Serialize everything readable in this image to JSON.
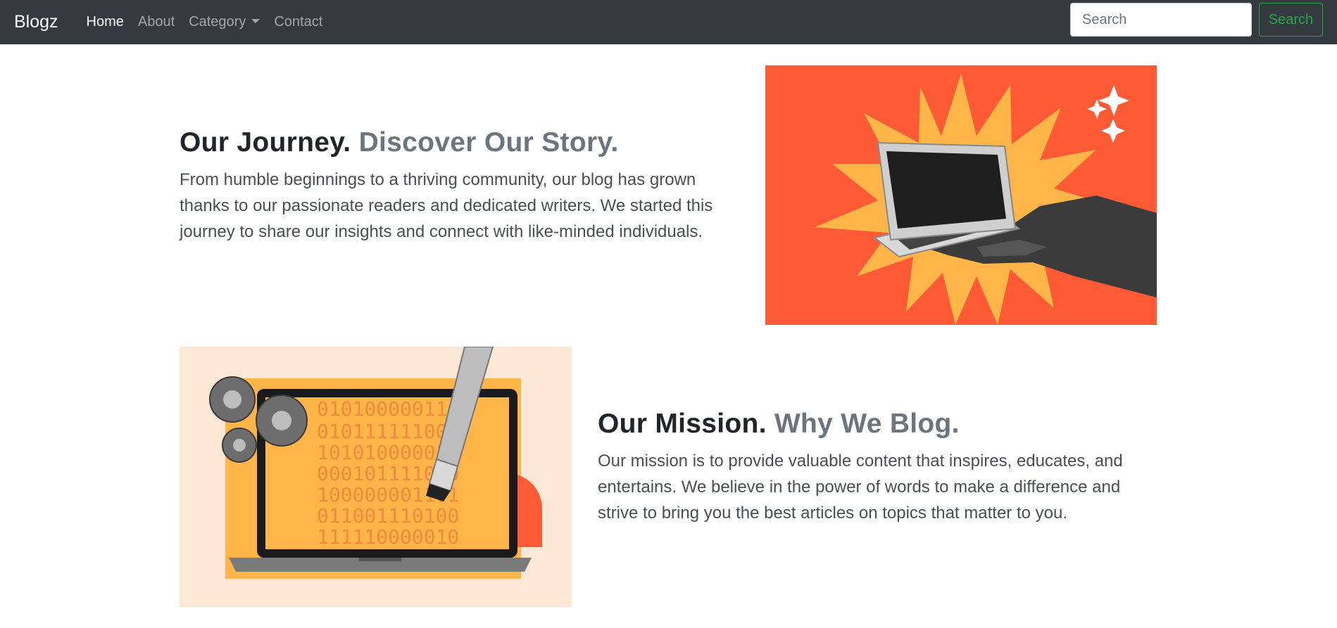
{
  "navbar": {
    "brand": "Blogz",
    "links": [
      {
        "label": "Home",
        "active": true
      },
      {
        "label": "About",
        "active": false
      },
      {
        "label": "Category",
        "active": false,
        "dropdown": true
      },
      {
        "label": "Contact",
        "active": false
      }
    ],
    "search": {
      "placeholder": "Search",
      "value": "",
      "button_label": "Search"
    }
  },
  "sections": [
    {
      "title": "Our Journey.",
      "subtitle": "Discover Our Story.",
      "body": "From humble beginnings to a thriving community, our blog has grown thanks to our passionate readers and dedicated writers. We started this journey to share our insights and connect with like-minded individuals.",
      "image_icon": "laptop-in-hand-illustration"
    },
    {
      "title": "Our Mission.",
      "subtitle": "Why We Blog.",
      "body": "Our mission is to provide valuable content that inspires, educates, and entertains. We believe in the power of words to make a difference and strive to bring you the best articles on topics that matter to you.",
      "image_icon": "laptop-binary-gears-illustration"
    }
  ],
  "colors": {
    "navbar_bg": "#343a40",
    "accent_green": "#28a745",
    "muted_text": "#6c757d",
    "illustration_orange": "#ff5a36",
    "illustration_yellow": "#ffb547",
    "illustration_cream": "#fde8d5"
  }
}
